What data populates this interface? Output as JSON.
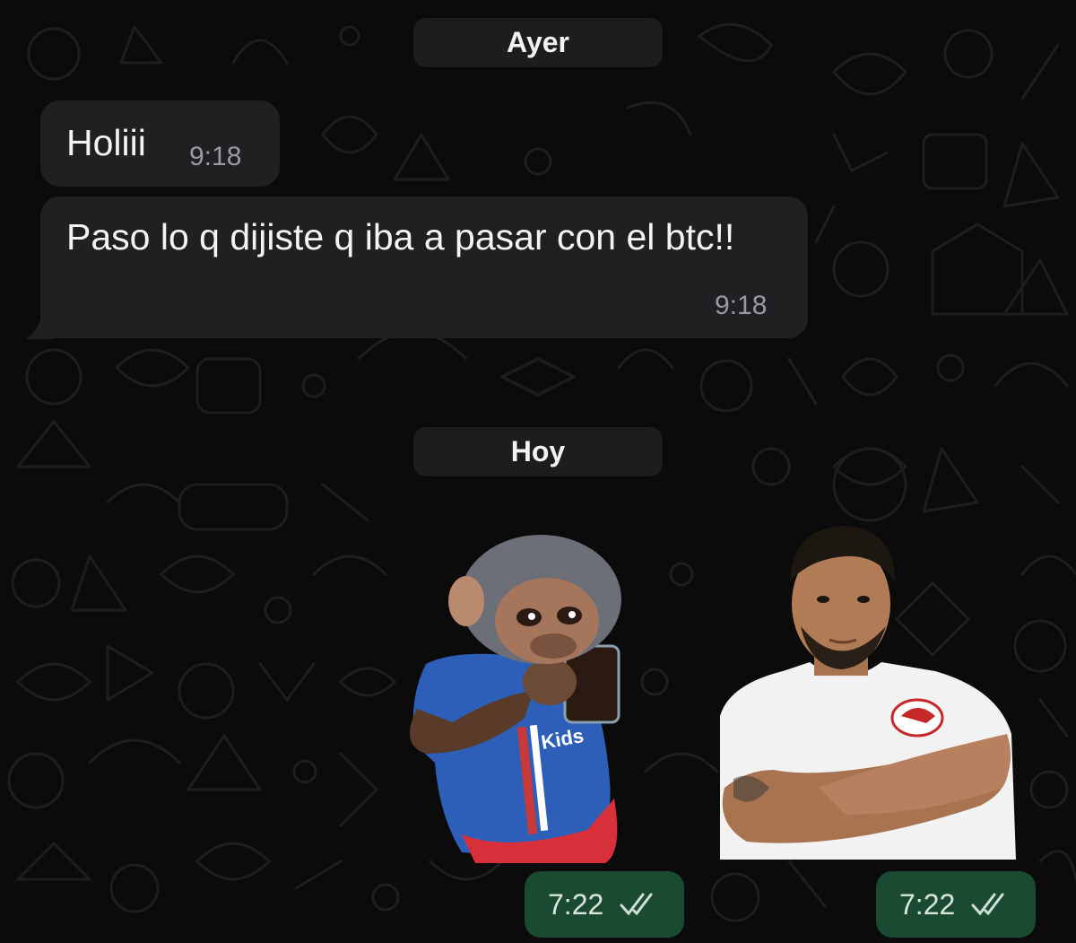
{
  "date_separators": {
    "yesterday": "Ayer",
    "today": "Hoy"
  },
  "messages": [
    {
      "text": "Holiii",
      "time": "9:18",
      "direction": "incoming"
    },
    {
      "text": "Paso lo q dijiste q iba a pasar con el btc!!",
      "time": "9:18",
      "direction": "incoming"
    }
  ],
  "stickers": [
    {
      "subject": "chimpanzee in blue shirt holding a drink",
      "time": "7:22",
      "status": "read",
      "direction": "outgoing"
    },
    {
      "subject": "man in white t-shirt with arms crossed",
      "time": "7:22",
      "status": "read",
      "direction": "outgoing"
    }
  ],
  "colors": {
    "background": "#0b0b0b",
    "incoming_bubble": "#202023",
    "outgoing_bubble": "#1b4a32",
    "date_pill": "#1d1d1f",
    "read_ticks": "#cfe0d6"
  }
}
